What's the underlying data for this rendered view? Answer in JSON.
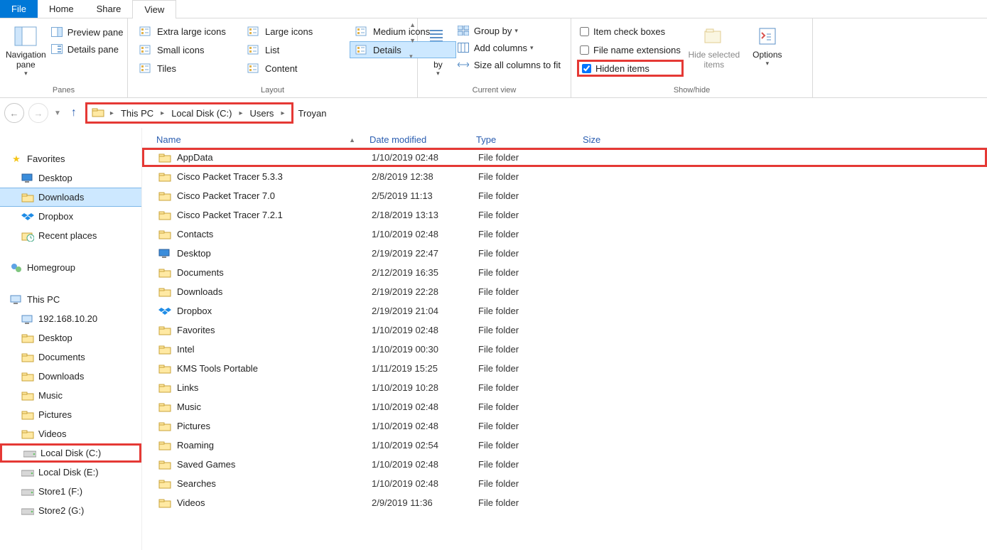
{
  "tabs": {
    "file": "File",
    "home": "Home",
    "share": "Share",
    "view": "View"
  },
  "ribbon": {
    "panes": {
      "label": "Panes",
      "nav": "Navigation\npane",
      "nav_dd": "▾",
      "preview": "Preview pane",
      "details": "Details pane"
    },
    "layout": {
      "label": "Layout",
      "items": [
        [
          "Extra large icons",
          "Large icons",
          "Medium icons"
        ],
        [
          "Small icons",
          "List",
          "Details"
        ],
        [
          "Tiles",
          "Content",
          ""
        ]
      ],
      "selected": "Details"
    },
    "current": {
      "label": "Current view",
      "sort": "Sort\nby",
      "sort_dd": "▾",
      "group": "Group by",
      "group_dd": "▾",
      "addcols": "Add columns",
      "addcols_dd": "▾",
      "sizeall": "Size all columns to fit"
    },
    "showhide": {
      "label": "Show/hide",
      "itemchk": "Item check boxes",
      "ext": "File name extensions",
      "hidden": "Hidden items",
      "hidesel": "Hide selected\nitems",
      "options": "Options",
      "options_dd": "▾"
    }
  },
  "breadcrumb": [
    "This PC",
    "Local Disk (C:)",
    "Users",
    "Troyan"
  ],
  "tree": {
    "favorites": {
      "label": "Favorites",
      "items": [
        "Desktop",
        "Downloads",
        "Dropbox",
        "Recent places"
      ],
      "selected": "Downloads"
    },
    "homegroup": "Homegroup",
    "thispc": {
      "label": "This PC",
      "items": [
        "192.168.10.20",
        "Desktop",
        "Documents",
        "Downloads",
        "Music",
        "Pictures",
        "Videos",
        "Local Disk (C:)",
        "Local Disk (E:)",
        "Store1 (F:)",
        "Store2 (G:)"
      ],
      "selected": "Local Disk (C:)"
    }
  },
  "columns": {
    "name": "Name",
    "date": "Date modified",
    "type": "Type",
    "size": "Size"
  },
  "rows": [
    {
      "name": "AppData",
      "date": "1/10/2019 02:48",
      "type": "File folder",
      "red": true,
      "icon": "folder"
    },
    {
      "name": "Cisco Packet Tracer 5.3.3",
      "date": "2/8/2019 12:38",
      "type": "File folder",
      "icon": "folder"
    },
    {
      "name": "Cisco Packet Tracer 7.0",
      "date": "2/5/2019 11:13",
      "type": "File folder",
      "icon": "folder"
    },
    {
      "name": "Cisco Packet Tracer 7.2.1",
      "date": "2/18/2019 13:13",
      "type": "File folder",
      "icon": "folder"
    },
    {
      "name": "Contacts",
      "date": "1/10/2019 02:48",
      "type": "File folder",
      "icon": "contacts"
    },
    {
      "name": "Desktop",
      "date": "2/19/2019 22:47",
      "type": "File folder",
      "icon": "desktop"
    },
    {
      "name": "Documents",
      "date": "2/12/2019 16:35",
      "type": "File folder",
      "icon": "documents"
    },
    {
      "name": "Downloads",
      "date": "2/19/2019 22:28",
      "type": "File folder",
      "icon": "downloads"
    },
    {
      "name": "Dropbox",
      "date": "2/19/2019 21:04",
      "type": "File folder",
      "icon": "dropbox"
    },
    {
      "name": "Favorites",
      "date": "1/10/2019 02:48",
      "type": "File folder",
      "icon": "favorites"
    },
    {
      "name": "Intel",
      "date": "1/10/2019 00:30",
      "type": "File folder",
      "icon": "folder"
    },
    {
      "name": "KMS Tools Portable",
      "date": "1/11/2019 15:25",
      "type": "File folder",
      "icon": "folder"
    },
    {
      "name": "Links",
      "date": "1/10/2019 10:28",
      "type": "File folder",
      "icon": "links"
    },
    {
      "name": "Music",
      "date": "1/10/2019 02:48",
      "type": "File folder",
      "icon": "music"
    },
    {
      "name": "Pictures",
      "date": "1/10/2019 02:48",
      "type": "File folder",
      "icon": "pictures"
    },
    {
      "name": "Roaming",
      "date": "1/10/2019 02:54",
      "type": "File folder",
      "icon": "folder"
    },
    {
      "name": "Saved Games",
      "date": "1/10/2019 02:48",
      "type": "File folder",
      "icon": "games"
    },
    {
      "name": "Searches",
      "date": "1/10/2019 02:48",
      "type": "File folder",
      "icon": "searches"
    },
    {
      "name": "Videos",
      "date": "2/9/2019 11:36",
      "type": "File folder",
      "icon": "videos"
    }
  ]
}
